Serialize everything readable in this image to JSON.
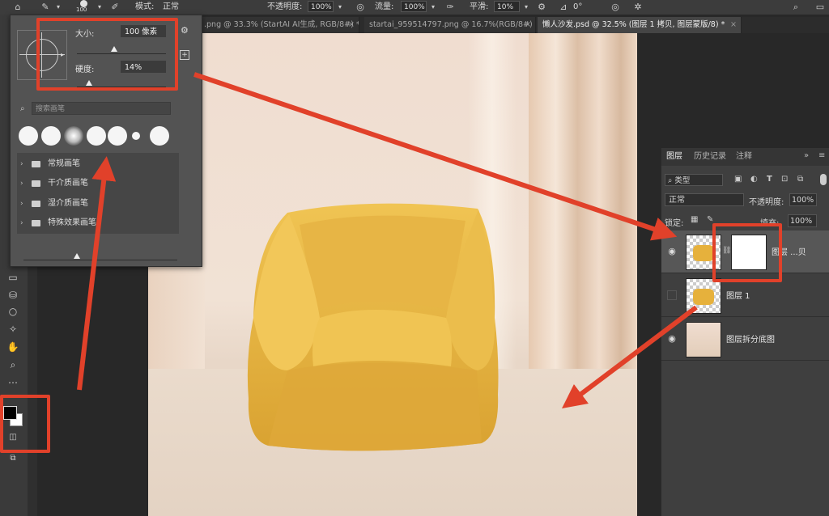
{
  "options_bar": {
    "brush_size": "100",
    "mode_label": "模式:",
    "mode_value": "正常",
    "opacity_label": "不透明度:",
    "opacity_value": "100%",
    "flow_label": "流量:",
    "flow_value": "100%",
    "smoothing_label": "平滑:",
    "smoothing_value": "10%",
    "angle_value": "0°"
  },
  "tabs": [
    {
      "label": ".png @ 33.3% (StartAI AI生成, RGB/8#) *",
      "active": false
    },
    {
      "label": "startai_959514797.png @ 16.7%(RGB/8#)",
      "active": false
    },
    {
      "label": "懒人沙发.psd @ 32.5% (图层 1 拷贝, 图层蒙版/8) *",
      "active": true
    }
  ],
  "brush_popup": {
    "size_label": "大小:",
    "size_value": "100 像素",
    "size_fraction": 0.42,
    "hardness_label": "硬度:",
    "hardness_value": "14%",
    "hardness_fraction": 0.14,
    "search_placeholder": "搜索画笔",
    "folders": [
      "常规画笔",
      "干介质画笔",
      "湿介质画笔",
      "特殊效果画笔"
    ]
  },
  "layers_panel": {
    "tabs": [
      "图层",
      "历史记录",
      "注释"
    ],
    "filter_label": "类型",
    "blend_mode": "正常",
    "opacity_label": "不透明度:",
    "opacity_value": "100%",
    "lock_label": "锁定:",
    "fill_label": "填充:",
    "fill_value": "100%",
    "layers": [
      {
        "name": "图层 ...贝",
        "visible": true,
        "has_mask": true
      },
      {
        "name": "图层 1",
        "visible": false,
        "has_mask": false
      },
      {
        "name": "图层拆分底图",
        "visible": true,
        "has_mask": false
      }
    ]
  },
  "colors": {
    "annotation_red": "#e1412a",
    "sofa_yellow": "#e8b43a",
    "panel_bg": "#3f3f3f"
  }
}
